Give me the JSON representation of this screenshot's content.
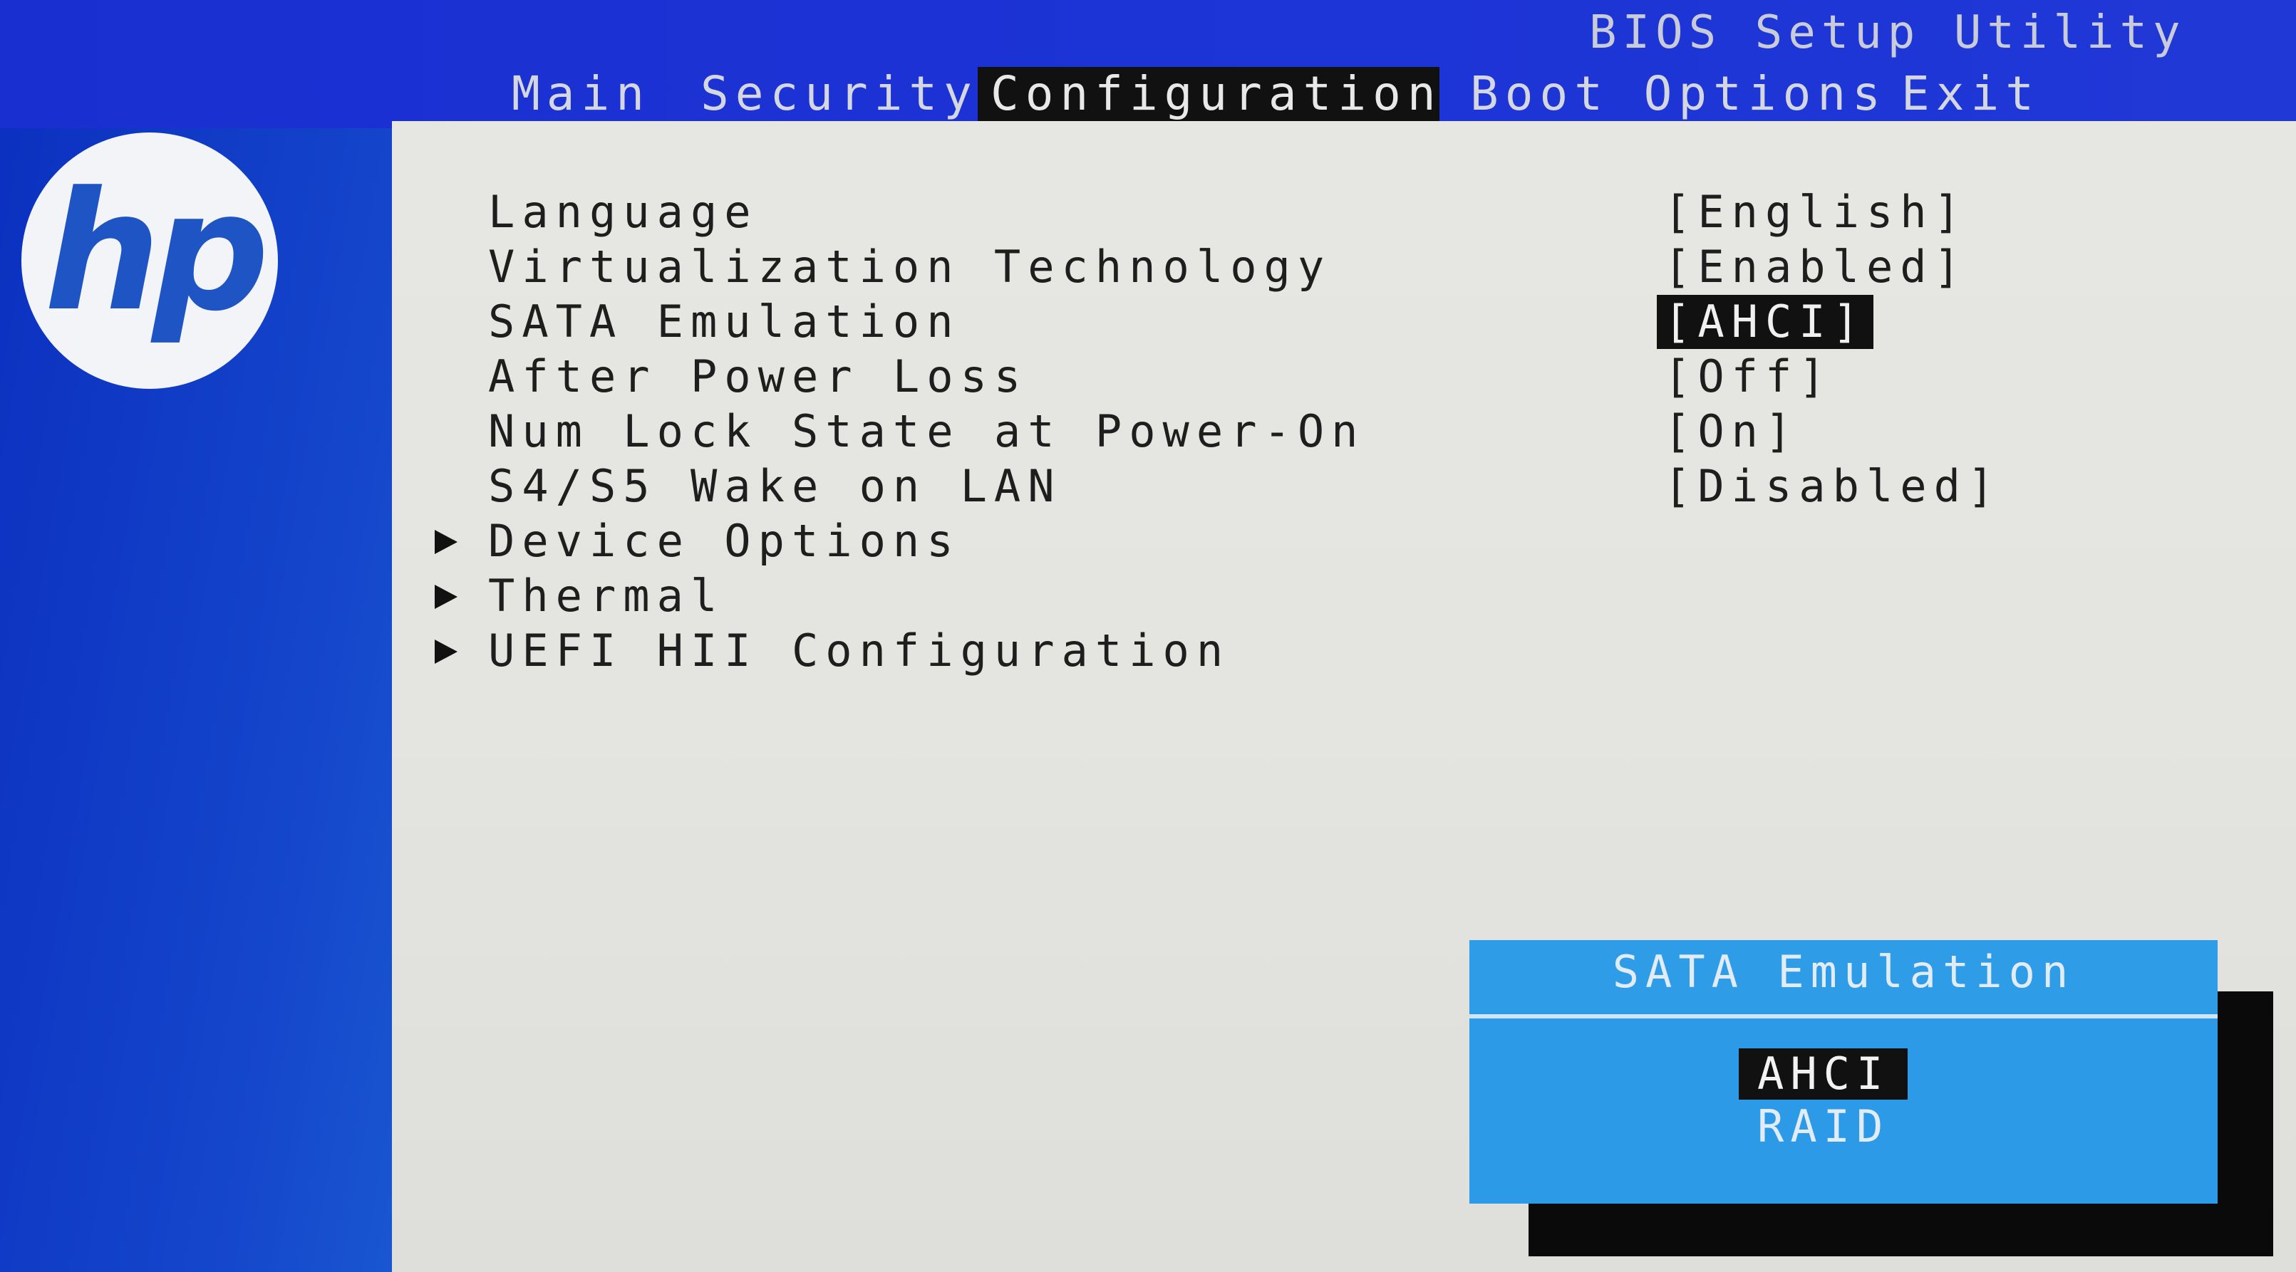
{
  "header": {
    "utility_title": "BIOS Setup Utility",
    "tabs": [
      {
        "label": "Main"
      },
      {
        "label": "Security"
      },
      {
        "label": "Configuration",
        "active": true
      },
      {
        "label": "Boot Options"
      },
      {
        "label": "Exit"
      }
    ]
  },
  "logo": {
    "text": "hp"
  },
  "settings": [
    {
      "label": "Language",
      "value": "[English]"
    },
    {
      "label": "Virtualization Technology",
      "value": "[Enabled]"
    },
    {
      "label": "SATA Emulation",
      "value": "[AHCI]",
      "selected": true
    },
    {
      "label": "After Power Loss",
      "value": "[Off]"
    },
    {
      "label": "Num Lock State at Power-On",
      "value": "[On]"
    },
    {
      "label": "S4/S5 Wake on LAN",
      "value": "[Disabled]"
    }
  ],
  "submenus": [
    {
      "label": "Device Options"
    },
    {
      "label": "Thermal"
    },
    {
      "label": "UEFI HII Configuration"
    }
  ],
  "popup": {
    "title": "SATA Emulation",
    "options": [
      "AHCI",
      "RAID"
    ],
    "selected": "AHCI"
  },
  "colors": {
    "top_band": "#1d34d6",
    "panel": "#e4e4e0",
    "popup": "#2c9ae6",
    "highlight": "#111111"
  }
}
